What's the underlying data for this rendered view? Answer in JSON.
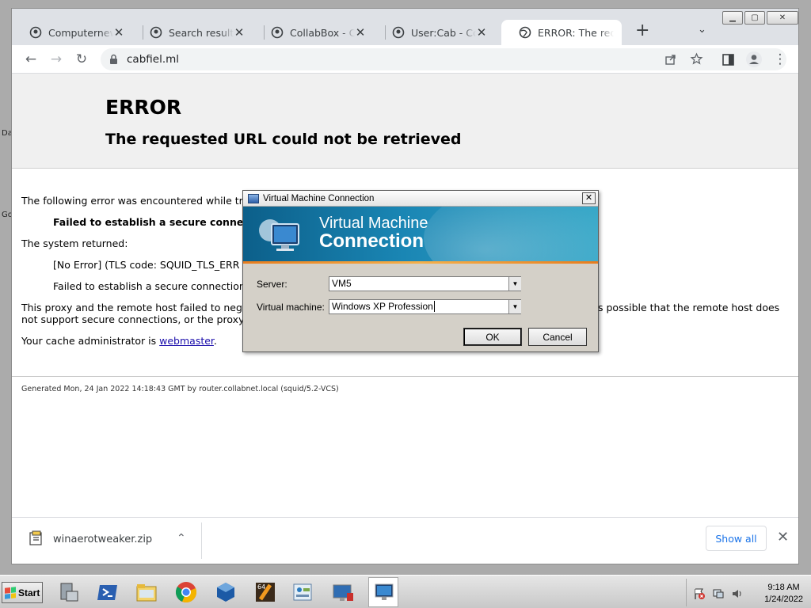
{
  "desktop": {
    "labels": [
      "Da",
      "Go"
    ]
  },
  "browser": {
    "tabs": [
      {
        "title": "Computernewb's",
        "active": false
      },
      {
        "title": "Search results fo",
        "active": false
      },
      {
        "title": "CollabBox - Com",
        "active": false
      },
      {
        "title": "User:Cab - Comp",
        "active": false
      },
      {
        "title": "ERROR: The requ",
        "active": true
      }
    ],
    "address": "cabfiel.ml",
    "page": {
      "h1": "ERROR",
      "h2": "The requested URL could not be retrieved",
      "line1": "The following error was encountered while try",
      "line2": "Failed to establish a secure connect",
      "line3": "The system returned:",
      "line4": "[No Error] (TLS code: SQUID_TLS_ERR",
      "line5": "Failed to establish a secure connection:",
      "line6a": "This proxy and the remote host failed to nego",
      "line6b": "s possible that the remote host does",
      "line7": "not support secure connections, or the proxy i",
      "admin_text": "Your cache administrator is",
      "admin_link": "webmaster",
      "admin_end": ".",
      "footer": "Generated Mon, 24 Jan 2022 14:18:43 GMT by router.collabnet.local (squid/5.2-VCS)"
    },
    "download": {
      "filename": "winaerotweaker.zip",
      "show_all": "Show all"
    }
  },
  "dialog": {
    "title": "Virtual Machine Connection",
    "banner_line1": "Virtual Machine",
    "banner_line2": "Connection",
    "server_label": "Server:",
    "server_value": "VM5",
    "vm_label": "Virtual machine:",
    "vm_value": "Windows XP Profession",
    "ok": "OK",
    "cancel": "Cancel"
  },
  "taskbar": {
    "start": "Start",
    "time": "9:18 AM",
    "date": "1/24/2022"
  }
}
